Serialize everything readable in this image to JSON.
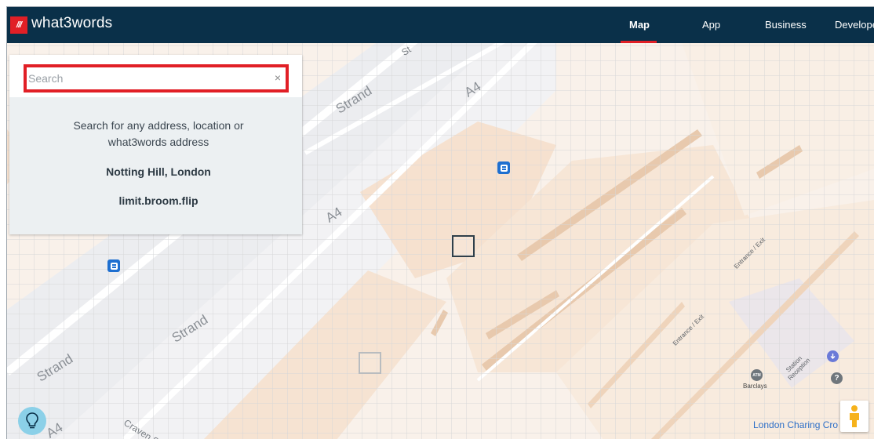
{
  "brand": {
    "logo_glyph": "///",
    "name": "what3words",
    "color": "#e11f26"
  },
  "nav": {
    "items": [
      {
        "label": "Map",
        "active": true
      },
      {
        "label": "App",
        "active": false
      },
      {
        "label": "Business",
        "active": false
      },
      {
        "label": "Develope",
        "active": false
      }
    ]
  },
  "search": {
    "placeholder": "Search",
    "clear_icon": "×",
    "hint": "Search for any address, location or what3words address",
    "examples": [
      "Notting Hill, London",
      "limit.broom.flip"
    ]
  },
  "map": {
    "street_labels": [
      "Strand",
      "A4",
      "A4",
      "Strand",
      "Strand",
      "Craven S",
      "A4",
      "St"
    ],
    "poi_labels": [
      "Entrance / Exit",
      "Entrance / Exit",
      "Station Reception"
    ],
    "atm_text": "ATM",
    "barclays": "Barclays",
    "station_link": "London Charing Cro",
    "info_glyph": "?",
    "icons": {
      "bus": "bus-stop-icon",
      "tip": "lightbulb-icon",
      "pegman": "street-view-pegman-icon",
      "transit": "transit-icon"
    }
  },
  "colors": {
    "topbar": "#0a3049",
    "accent": "#e11f26",
    "tip": "#8bd0e8",
    "link": "#2e6fc7"
  }
}
